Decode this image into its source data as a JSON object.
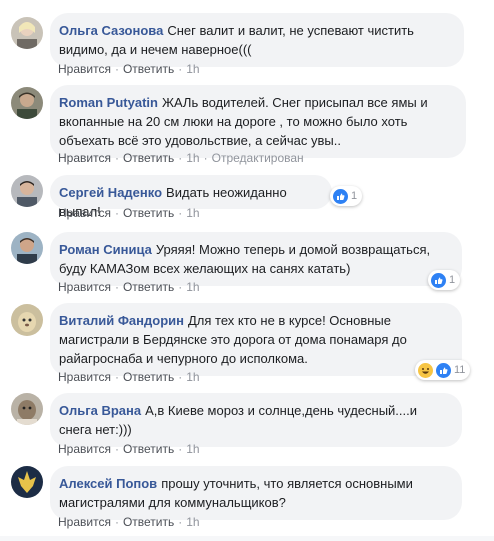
{
  "actions": {
    "like": "Нравится",
    "reply": "Ответить",
    "sep": "·"
  },
  "colors": {
    "author": "#385898",
    "bubble": "#f2f3f5",
    "link": "#4b4f56",
    "meta": "#90949c",
    "like_badge": "#2e81f4",
    "haha_badge": "#f7c544"
  },
  "comments": [
    {
      "author": "Ольга Сазонова",
      "text": "Снег валит и валит, не успевают чистить видимо, да и нечем наверное(((",
      "time": "1h",
      "edited": "",
      "reaction_count": ""
    },
    {
      "author": "Roman Putyatin",
      "text": "ЖАЛь водителей. Снег присыпал все ямы и вкопанные на 20 см люки на дороге , то можно было хоть объехать всё это удовольствие, а сейчас увы..",
      "time": "1h",
      "edited": "Отредактирован",
      "reaction_count": ""
    },
    {
      "author": "Сергей Наденко",
      "text": "Видать неожиданно выпал!",
      "time": "1h",
      "edited": "",
      "reaction_count": "1",
      "reaction_icons": [
        "like-icon"
      ]
    },
    {
      "author": "Роман Синица",
      "text": "Уряяя! Можно теперь и домой возвращаться, буду КАМАЗом всех желающих на санях катать)",
      "time": "1h",
      "edited": "",
      "reaction_count": "1",
      "reaction_icons": [
        "like-icon"
      ]
    },
    {
      "author": "Виталий Фандорин",
      "text": "Для тех кто не в курсе! Основные магистрали в Бердянске это дорога от дома понамаря до райагроснаба и чепурного до исполкома.",
      "time": "1h",
      "edited": "",
      "reaction_count": "11",
      "reaction_icons": [
        "haha-icon",
        "like-icon"
      ]
    },
    {
      "author": "Ольга Врана",
      "text": "А,в Киеве мороз и солнце,день чудесный....и снега нет:)))",
      "time": "1h",
      "edited": "",
      "reaction_count": ""
    },
    {
      "author": "Алексей Попов",
      "text": "прошу уточнить, что является основными магистралями для коммунальщиков?",
      "time": "1h",
      "edited": "",
      "reaction_count": ""
    }
  ]
}
